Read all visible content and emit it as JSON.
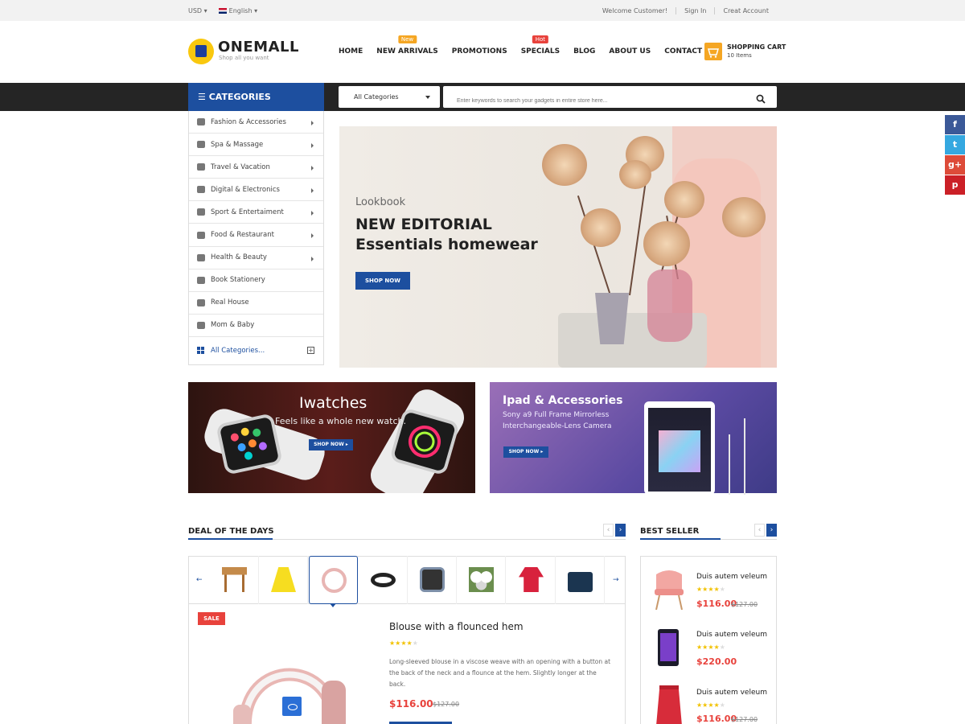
{
  "topbar": {
    "currency": "USD",
    "language": "English",
    "welcome": "Welcome Customer!",
    "signin": "Sign In",
    "create_account": "Creat Account"
  },
  "brand": {
    "name": "ONEMALL",
    "tagline": "Shop all you want",
    "logo_color": "#f9c80e",
    "accent": "#1d4f9f"
  },
  "nav": {
    "items": [
      {
        "label": "HOME"
      },
      {
        "label": "NEW ARRIVALS",
        "badge": "New",
        "badge_color": "#f5a623"
      },
      {
        "label": "PROMOTIONS"
      },
      {
        "label": "SPECIALS",
        "badge": "Hot",
        "badge_color": "#e8423c"
      },
      {
        "label": "BLOG"
      },
      {
        "label": "ABOUT US"
      },
      {
        "label": "CONTACT US"
      }
    ]
  },
  "cart": {
    "title": "SHOPPING CART",
    "items": "10 Items"
  },
  "categories": {
    "header": "CATEGORIES",
    "items": [
      {
        "label": "Fashion & Accessories",
        "icon": "shirt-icon",
        "has_sub": true
      },
      {
        "label": "Spa & Massage",
        "icon": "lotus-icon",
        "has_sub": true
      },
      {
        "label": "Travel & Vacation",
        "icon": "walker-icon",
        "has_sub": true
      },
      {
        "label": "Digital & Electronics",
        "icon": "laptop-icon",
        "has_sub": true
      },
      {
        "label": "Sport & Entertaiment",
        "icon": "bike-icon",
        "has_sub": true
      },
      {
        "label": "Food & Restaurant",
        "icon": "burger-icon",
        "has_sub": true
      },
      {
        "label": "Health & Beauty",
        "icon": "bottle-icon",
        "has_sub": true
      },
      {
        "label": "Book Stationery",
        "icon": "book-icon",
        "has_sub": false
      },
      {
        "label": "Real House",
        "icon": "house-icon",
        "has_sub": false
      },
      {
        "label": "Mom & Baby",
        "icon": "baby-bottle-icon",
        "has_sub": false
      }
    ],
    "all_label": "All Categories..."
  },
  "search": {
    "category": "All Categories",
    "placeholder": "Enter keywords to search your gadgets in entire store here..."
  },
  "hero": {
    "kicker": "Lookbook",
    "line1": "NEW EDITORIAL",
    "line2": "Essentials homewear",
    "button": "SHOP NOW"
  },
  "promo_watches": {
    "title": "Iwatches",
    "subtitle": "Feels like a whole new watch.",
    "button": "SHOP NOW"
  },
  "promo_ipad": {
    "title": "Ipad & Accessories",
    "line1": "Sony a9 Full Frame Mirrorless",
    "line2": "Interchangeable-Lens Camera",
    "button": "SHOP NOW"
  },
  "deal": {
    "title": "DEAL OF THE DAYS",
    "thumbs": [
      "stool",
      "yellow-top",
      "headphones",
      "bracelet",
      "smartwatch",
      "flowers",
      "red-blouse",
      "handbag"
    ],
    "active_thumb": 2,
    "sale_badge": "SALE",
    "product_name": "Blouse with a flounced hem",
    "rating": 4,
    "description": "Long-sleeved blouse in a viscose weave with an opening with a button at the back of the neck and a flounce at the hem. Slightly longer at the back.",
    "price": "$116.00",
    "old_price": "$127.00"
  },
  "best_seller": {
    "title": "BEST SELLER",
    "items": [
      {
        "name": "Duis autem veleum",
        "price": "$116.00",
        "old_price": "$127.00",
        "rating": 4,
        "image": "pink-chair"
      },
      {
        "name": "Duis autem veleum",
        "price": "$220.00",
        "old_price": "",
        "rating": 4,
        "image": "purple-phone"
      },
      {
        "name": "Duis autem veleum",
        "price": "$116.00",
        "old_price": "$127.00",
        "rating": 4,
        "image": "red-skirt"
      }
    ]
  },
  "social": [
    {
      "icon": "facebook-icon",
      "glyph": "f",
      "color": "#3b5998"
    },
    {
      "icon": "twitter-icon",
      "glyph": "t",
      "color": "#35a8e0"
    },
    {
      "icon": "google-plus-icon",
      "glyph": "g+",
      "color": "#dd4b39"
    },
    {
      "icon": "pinterest-icon",
      "glyph": "p",
      "color": "#cb2027"
    }
  ]
}
